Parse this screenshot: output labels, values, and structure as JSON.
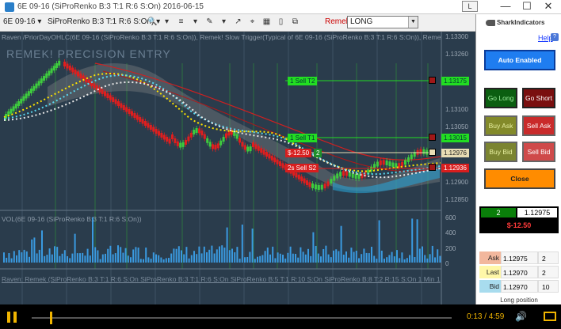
{
  "window": {
    "title": "6E 09-16 (SiProRenko B:3 T:1 R:6 S:On)  2016-06-15",
    "l_button": "L",
    "min": "—",
    "max": "☐",
    "close": "✕"
  },
  "toolbar": {
    "instrument": "6E 09-16 ▾",
    "chart_type": "SiProRenko B:3 T:1 R:6 S:On) ▾",
    "tool_icons": [
      "🔍",
      "▾",
      "≡",
      "▾",
      "✎",
      "▾",
      "↗",
      "⌖",
      "▦",
      "▯",
      "⧉"
    ],
    "remek_label": "Remek",
    "strategy_value": "LONG"
  },
  "chart": {
    "indicator_title": "Raven /PriorDayOHLC(6E 09-16 (SiProRenko B:3 T:1 R:6 S:On)), Remek! Slow Trigger(Typical of 6E 09-16 (SiProRenko B:3 T:1 R:6 S:On)), Remek! S",
    "watermark": "REMEK! PRECISION ENTRY",
    "volume_title": "VOL(6E 09-16 (SiProRenko B:3 T:1 R:6 S:On))",
    "bottom_indicator": "Raven: Remek (SiProRenko B:3 T:1 R:6 S:On  SiProRenko B:3 T:1 R:6 S:On  SiProRenko B:5 T:1 R:10 S:On  SiProRenko B:8 T:2 R:15 S:On  1 Min  1",
    "price_ticks": [
      "1.13300",
      "1.13260",
      "1.13175",
      "1.13100",
      "1.13050",
      "1.13015",
      "1.12976",
      "1.12936",
      "1.12900",
      "1.12850"
    ],
    "volume_ticks": [
      "600",
      "400",
      "200",
      "0"
    ],
    "orders": {
      "sell_t2": "1  Sell T2",
      "sell_t2_price": "1.13175",
      "sell_t1": "1  Sell T1",
      "sell_t1_price": "1.13015",
      "pnl": "$-12.50",
      "pnl_qty": "2",
      "last_price": "1.12976",
      "stop_label": "2s  Sell S2",
      "stop_price": "1.12936"
    }
  },
  "panel": {
    "brand": "SharkIndicators",
    "help": "Help",
    "help_q": "?",
    "auto_enabled": "Auto Enabled",
    "go_long": "Go Long",
    "go_short": "Go Short",
    "buy_ask": "Buy Ask",
    "sell_ask": "Sell Ask",
    "buy_bid": "Buy Bid",
    "sell_bid": "Sell Bid",
    "close": "Close",
    "position": {
      "qty": "2",
      "price": "1.12975",
      "pnl": "$-12.50"
    },
    "quotes": [
      {
        "label": "Ask",
        "price": "1.12975",
        "size": "2"
      },
      {
        "label": "Last",
        "price": "1.12970",
        "size": "2"
      },
      {
        "label": "Bid",
        "price": "1.12970",
        "size": "10"
      }
    ],
    "position_label": "Long position"
  },
  "player": {
    "time": "0:13 / 4:59",
    "progress": 0.043,
    "volume_icon": "🔊"
  },
  "colors": {
    "chart_bg": "#2a3c4c",
    "up_bar": "#3ecb3e",
    "down_bar": "#e01e1e",
    "accent_player": "#f0b400"
  }
}
